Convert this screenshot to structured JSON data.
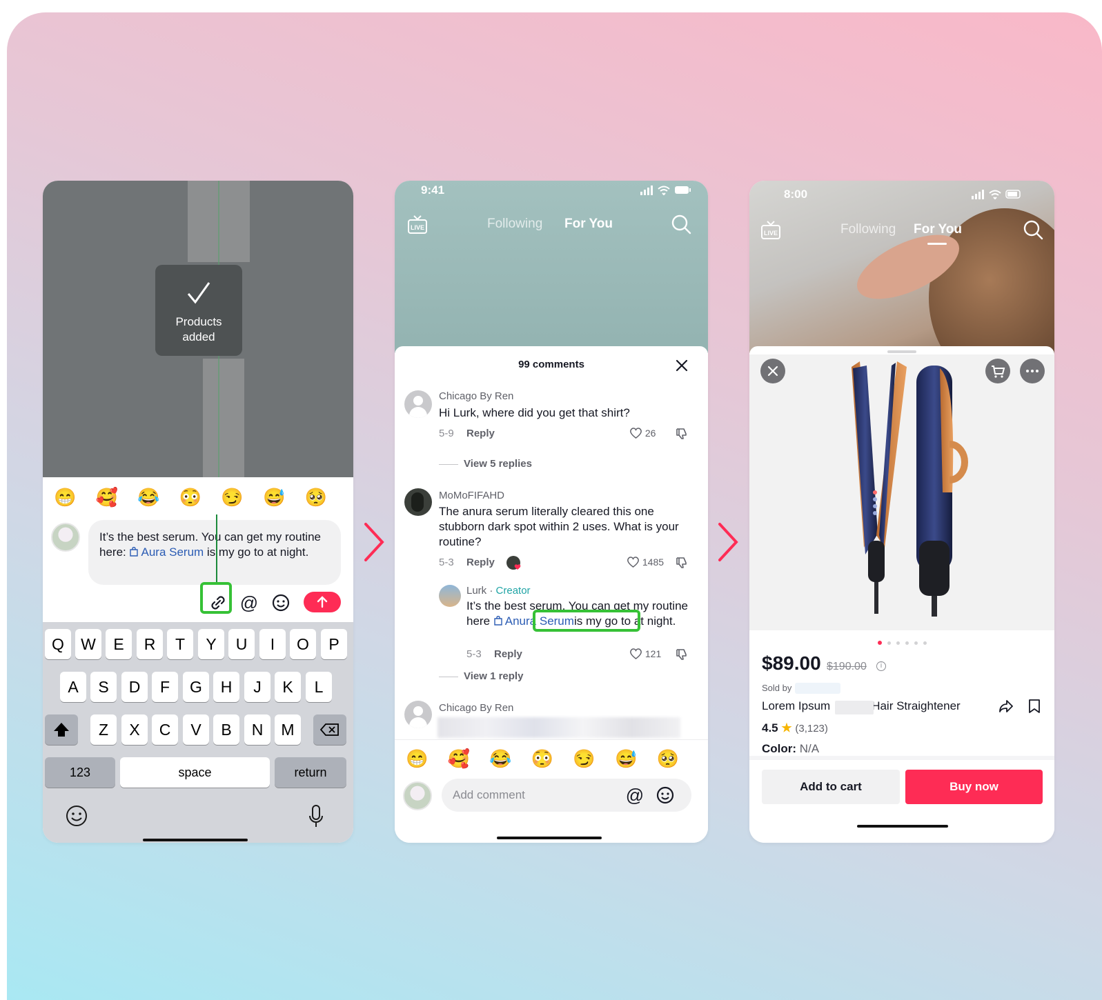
{
  "colors": {
    "accent": "#fe2c55",
    "highlight": "#36c136",
    "link": "#2b5cb4",
    "creator": "#1fa4a5"
  },
  "phone1": {
    "toast": {
      "text_line1": "Products",
      "text_line2": "added",
      "icon": "check-icon"
    },
    "emoji_row": [
      "😁",
      "🥰",
      "😂",
      "😳",
      "😏",
      "😅",
      "🥺"
    ],
    "draft": {
      "before": "It’s the best serum. You can get my routine here:",
      "product_link": "Aura Serum",
      "after": "is my go to at night."
    },
    "tools": {
      "link_icon": "link-icon",
      "mention": "@",
      "emoji_icon": "smile-icon",
      "send_icon": "arrow-up-icon"
    },
    "keyboard": {
      "row1": [
        "Q",
        "W",
        "E",
        "R",
        "T",
        "Y",
        "U",
        "I",
        "O",
        "P"
      ],
      "row2": [
        "A",
        "S",
        "D",
        "F",
        "G",
        "H",
        "J",
        "K",
        "L"
      ],
      "row3": [
        "Z",
        "X",
        "C",
        "V",
        "B",
        "N",
        "M"
      ],
      "numbers_label": "123",
      "space_label": "space",
      "return_label": "return"
    }
  },
  "phone2": {
    "status_time": "9:41",
    "nav": {
      "following": "Following",
      "for_you": "For You"
    },
    "comments_title": "99 comments",
    "comments": [
      {
        "user": "Chicago By Ren",
        "text": "Hi Lurk, where did you get that shirt?",
        "date": "5-9",
        "reply": "Reply",
        "likes": "26",
        "view_replies": "View 5 replies"
      },
      {
        "user": "MoMoFIFAHD",
        "text": "The anura serum literally cleared this one stubborn dark spot within 2 uses. What is your routine?",
        "date": "5-3",
        "reply": "Reply",
        "likes": "1485"
      },
      {
        "user": "Lurk",
        "badge": "Creator",
        "text_before": "It’s the best serum. You can get my routine here",
        "product_link": "Anura Serum",
        "text_after": "is my go to at night.",
        "date": "5-3",
        "reply": "Reply",
        "likes": "121",
        "view_replies": "View 1 reply"
      },
      {
        "user": "Chicago By Ren"
      }
    ],
    "emoji_row": [
      "😁",
      "🥰",
      "😂",
      "😳",
      "😏",
      "😅",
      "🥺"
    ],
    "add_comment_placeholder": "Add comment",
    "mention": "@"
  },
  "phone3": {
    "status_time": "8:00",
    "nav": {
      "following": "Following",
      "for_you": "For You"
    },
    "price": "$89.00",
    "old_price": "$190.00",
    "sold_by_label": "Sold by",
    "title_left": "Lorem Ipsum",
    "title_right": "Hair Straightener",
    "rating": "4.5",
    "rating_count": "(3,123)",
    "color_label": "Color:",
    "color_value": "N/A",
    "add_to_cart": "Add to cart",
    "buy_now": "Buy now",
    "image_count": 6,
    "active_image": 1
  }
}
